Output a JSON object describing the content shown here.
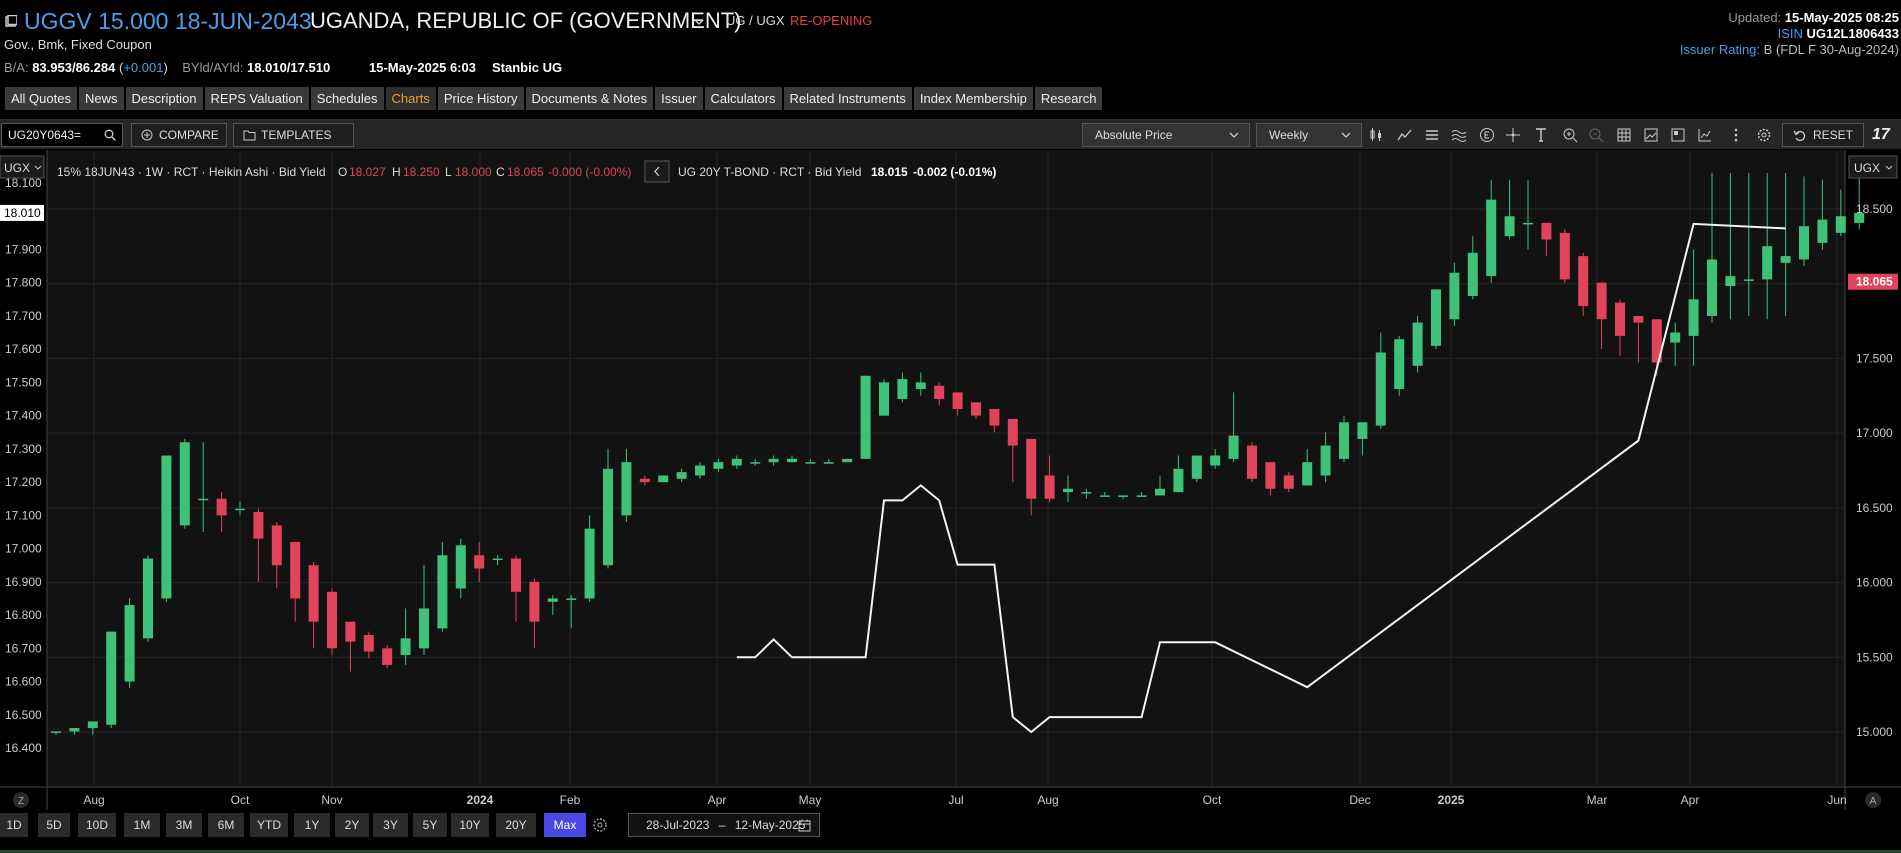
{
  "header": {
    "ticker": "UGGV 15.000 18-JUN-2043",
    "issuer": "UGANDA, REPUBLIC OF (GOVERNMENT)",
    "currency_pair": "UG / UGX",
    "status": "RE-OPENING",
    "subtitle": "Gov., Bmk, Fixed Coupon",
    "ba_label": "B/A:",
    "ba_value": "83.953/86.284",
    "ba_change": "+0.001",
    "yld_label": "BYld/AYld:",
    "yld_value": "18.010/17.510",
    "quote_date": "15-May-2025 6:03",
    "quote_source": "Stanbic UG",
    "updated_label": "Updated:",
    "updated_value": "15-May-2025 08:25",
    "isin_label": "ISIN",
    "isin_value": "UG12L1806433",
    "rating_label": "Issuer Rating:",
    "rating_value": "B (FDL F 30-Aug-2024)"
  },
  "tabs": [
    {
      "label": "All Quotes"
    },
    {
      "label": "News"
    },
    {
      "label": "Description"
    },
    {
      "label": "REPS Valuation"
    },
    {
      "label": "Schedules"
    },
    {
      "label": "Charts",
      "active": true
    },
    {
      "label": "Price History"
    },
    {
      "label": "Documents & Notes"
    },
    {
      "label": "Issuer"
    },
    {
      "label": "Calculators"
    },
    {
      "label": "Related Instruments"
    },
    {
      "label": "Index Membership"
    },
    {
      "label": "Research"
    }
  ],
  "toolbar": {
    "symbol": "UG20Y0643=",
    "compare_label": "COMPARE",
    "templates_label": "TEMPLATES",
    "price_type": "Absolute Price",
    "interval": "Weekly",
    "reset_label": "RESET"
  },
  "chart_data": {
    "type": "candlestick",
    "legend_main": {
      "name": "15% 18JUN43 · 1W · RCT · Heikin Ashi · Bid Yield",
      "o_label": "O",
      "o": "18.027",
      "h_label": "H",
      "h": "18.250",
      "l_label": "L",
      "l": "18.000",
      "c_label": "C",
      "c": "18.065",
      "chg": "-0.000 (-0.00%)"
    },
    "legend_compare": {
      "name": "UG 20Y T-BOND · RCT · Bid Yield",
      "value": "18.015",
      "chg": "-0.002 (-0.01%)"
    },
    "left_axis": {
      "currency": "UGX",
      "ticks": [
        "18.100",
        "18.000",
        "17.900",
        "17.800",
        "17.700",
        "17.600",
        "17.500",
        "17.400",
        "17.300",
        "17.200",
        "17.100",
        "17.000",
        "16.900",
        "16.800",
        "16.700",
        "16.600",
        "16.500",
        "16.400"
      ],
      "marker": "18.010",
      "range": [
        16.4,
        18.1
      ]
    },
    "right_axis": {
      "currency": "UGX",
      "ticks": [
        "18.500",
        "18.000",
        "17.500",
        "17.000",
        "16.500",
        "16.000",
        "15.500",
        "15.000"
      ],
      "marker": "18.065",
      "range": [
        15.0,
        18.5
      ]
    },
    "x_ticks": [
      "Aug",
      "Oct",
      "Nov",
      "2024",
      "Feb",
      "Apr",
      "May",
      "Jul",
      "Aug",
      "Oct",
      "Dec",
      "2025",
      "Mar",
      "Apr",
      "Jun"
    ],
    "candles": [
      [
        16.45,
        16.45,
        16.44,
        16.45
      ],
      [
        16.45,
        16.46,
        16.44,
        16.46
      ],
      [
        16.46,
        16.48,
        16.44,
        16.48
      ],
      [
        16.47,
        16.75,
        16.46,
        16.75
      ],
      [
        16.6,
        16.83,
        16.58,
        16.85
      ],
      [
        16.73,
        16.97,
        16.72,
        16.98
      ],
      [
        16.85,
        17.28,
        16.84,
        17.28
      ],
      [
        17.07,
        17.32,
        17.06,
        17.33
      ],
      [
        17.15,
        17.15,
        17.05,
        17.32
      ],
      [
        17.15,
        17.1,
        17.05,
        17.17
      ],
      [
        17.12,
        17.12,
        17.1,
        17.14
      ],
      [
        17.11,
        17.03,
        16.9,
        17.12
      ],
      [
        17.07,
        16.95,
        16.88,
        17.08
      ],
      [
        17.02,
        16.85,
        16.78,
        17.02
      ],
      [
        16.95,
        16.78,
        16.7,
        16.96
      ],
      [
        16.87,
        16.7,
        16.68,
        16.88
      ],
      [
        16.78,
        16.72,
        16.63,
        16.78
      ],
      [
        16.74,
        16.69,
        16.67,
        16.75
      ],
      [
        16.7,
        16.65,
        16.64,
        16.71
      ],
      [
        16.68,
        16.73,
        16.65,
        16.82
      ],
      [
        16.7,
        16.82,
        16.68,
        16.95
      ],
      [
        16.76,
        16.98,
        16.75,
        17.02
      ],
      [
        16.88,
        17.01,
        16.85,
        17.03
      ],
      [
        16.98,
        16.94,
        16.9,
        17.02
      ],
      [
        16.97,
        16.97,
        16.95,
        16.98
      ],
      [
        16.97,
        16.87,
        16.78,
        16.98
      ],
      [
        16.9,
        16.78,
        16.7,
        16.91
      ],
      [
        16.84,
        16.85,
        16.8,
        16.86
      ],
      [
        16.85,
        16.85,
        16.76,
        16.86
      ],
      [
        16.85,
        17.06,
        16.84,
        17.1
      ],
      [
        16.95,
        17.24,
        16.94,
        17.3
      ],
      [
        17.1,
        17.26,
        17.08,
        17.3
      ],
      [
        17.21,
        17.2,
        17.19,
        17.22
      ],
      [
        17.2,
        17.22,
        17.2,
        17.22
      ],
      [
        17.21,
        17.23,
        17.2,
        17.24
      ],
      [
        17.22,
        17.25,
        17.21,
        17.26
      ],
      [
        17.24,
        17.26,
        17.23,
        17.27
      ],
      [
        17.25,
        17.27,
        17.24,
        17.28
      ],
      [
        17.26,
        17.26,
        17.25,
        17.27
      ],
      [
        17.26,
        17.27,
        17.25,
        17.28
      ],
      [
        17.26,
        17.27,
        17.26,
        17.28
      ],
      [
        17.26,
        17.26,
        17.26,
        17.27
      ],
      [
        17.26,
        17.26,
        17.26,
        17.27
      ],
      [
        17.26,
        17.27,
        17.26,
        17.27
      ],
      [
        17.27,
        17.52,
        17.27,
        17.52
      ],
      [
        17.4,
        17.5,
        17.4,
        17.51
      ],
      [
        17.45,
        17.51,
        17.44,
        17.53
      ],
      [
        17.48,
        17.5,
        17.46,
        17.53
      ],
      [
        17.49,
        17.45,
        17.43,
        17.5
      ],
      [
        17.47,
        17.42,
        17.4,
        17.47
      ],
      [
        17.44,
        17.4,
        17.39,
        17.44
      ],
      [
        17.42,
        17.37,
        17.35,
        17.42
      ],
      [
        17.39,
        17.31,
        17.2,
        17.39
      ],
      [
        17.33,
        17.15,
        17.1,
        17.33
      ],
      [
        17.22,
        17.15,
        17.14,
        17.28
      ],
      [
        17.17,
        17.18,
        17.14,
        17.22
      ],
      [
        17.17,
        17.17,
        17.15,
        17.18
      ],
      [
        17.16,
        17.16,
        17.16,
        17.17
      ],
      [
        17.16,
        17.16,
        17.15,
        17.16
      ],
      [
        17.16,
        17.16,
        17.16,
        17.17
      ],
      [
        17.16,
        17.18,
        17.16,
        17.22
      ],
      [
        17.17,
        17.24,
        17.17,
        17.28
      ],
      [
        17.21,
        17.28,
        17.2,
        17.28
      ],
      [
        17.25,
        17.28,
        17.24,
        17.3
      ],
      [
        17.27,
        17.34,
        17.26,
        17.47
      ],
      [
        17.31,
        17.21,
        17.2,
        17.32
      ],
      [
        17.26,
        17.18,
        17.16,
        17.26
      ],
      [
        17.22,
        17.18,
        17.17,
        17.23
      ],
      [
        17.19,
        17.26,
        17.19,
        17.3
      ],
      [
        17.22,
        17.31,
        17.2,
        17.35
      ],
      [
        17.27,
        17.38,
        17.26,
        17.4
      ],
      [
        17.33,
        17.38,
        17.28,
        17.38
      ],
      [
        17.37,
        17.59,
        17.36,
        17.65
      ],
      [
        17.48,
        17.63,
        17.46,
        17.64
      ],
      [
        17.55,
        17.68,
        17.53,
        17.7
      ],
      [
        17.61,
        17.78,
        17.6,
        17.78
      ],
      [
        17.69,
        17.83,
        17.67,
        17.86
      ],
      [
        17.76,
        17.89,
        17.75,
        17.94
      ],
      [
        17.82,
        18.05,
        17.8,
        18.11
      ],
      [
        17.94,
        18.0,
        17.93,
        18.11
      ],
      [
        17.98,
        17.98,
        17.9,
        18.11
      ],
      [
        17.98,
        17.93,
        17.88,
        17.98
      ],
      [
        17.95,
        17.81,
        17.8,
        17.96
      ],
      [
        17.88,
        17.73,
        17.7,
        17.89
      ],
      [
        17.8,
        17.69,
        17.6,
        17.8
      ],
      [
        17.74,
        17.64,
        17.58,
        17.75
      ],
      [
        17.7,
        17.68,
        17.56,
        17.7
      ],
      [
        17.69,
        17.56,
        17.52,
        17.69
      ],
      [
        17.62,
        17.65,
        17.55,
        17.68
      ],
      [
        17.64,
        17.75,
        17.55,
        17.9
      ],
      [
        17.7,
        17.87,
        17.68,
        18.13
      ],
      [
        17.79,
        17.82,
        17.69,
        18.13
      ],
      [
        17.81,
        17.81,
        17.7,
        18.13
      ],
      [
        17.81,
        17.91,
        17.69,
        18.13
      ],
      [
        17.86,
        17.88,
        17.7,
        18.13
      ],
      [
        17.87,
        17.97,
        17.85,
        18.12
      ],
      [
        17.92,
        17.99,
        17.9,
        18.11
      ],
      [
        17.95,
        18.0,
        17.94,
        18.08
      ],
      [
        17.98,
        18.01,
        17.96,
        18.12
      ]
    ],
    "compare_line": [
      [
        37,
        15.5
      ],
      [
        38,
        15.5
      ],
      [
        39,
        15.62
      ],
      [
        40,
        15.5
      ],
      [
        44,
        15.5
      ],
      [
        45,
        16.55
      ],
      [
        46,
        16.55
      ],
      [
        47,
        16.65
      ],
      [
        48,
        16.55
      ],
      [
        49,
        16.12
      ],
      [
        51,
        16.12
      ],
      [
        52,
        15.1
      ],
      [
        53,
        15.0
      ],
      [
        54,
        15.1
      ],
      [
        59,
        15.1
      ],
      [
        60,
        15.6
      ],
      [
        63,
        15.6
      ],
      [
        68,
        15.3
      ],
      [
        86,
        16.95
      ],
      [
        89,
        18.4
      ],
      [
        94,
        18.37
      ]
    ]
  },
  "bottom": {
    "axis_z": "Z",
    "axis_a": "A",
    "ranges": [
      {
        "label": "1D"
      },
      {
        "label": "5D"
      },
      {
        "label": "10D"
      },
      {
        "label": "1M"
      },
      {
        "label": "3M"
      },
      {
        "label": "6M"
      },
      {
        "label": "YTD"
      },
      {
        "label": "1Y"
      },
      {
        "label": "2Y"
      },
      {
        "label": "3Y"
      },
      {
        "label": "5Y"
      },
      {
        "label": "10Y"
      },
      {
        "label": "20Y"
      },
      {
        "label": "Max",
        "active": true
      }
    ],
    "date_from": "28-Jul-2023",
    "date_sep": "–",
    "date_to": "12-May-2025"
  },
  "colors": {
    "up": "#3ec27a",
    "down": "#e0435a",
    "accent": "#4d9de8",
    "active_tab": "#f39c2b",
    "active_range": "#4a47e6"
  }
}
